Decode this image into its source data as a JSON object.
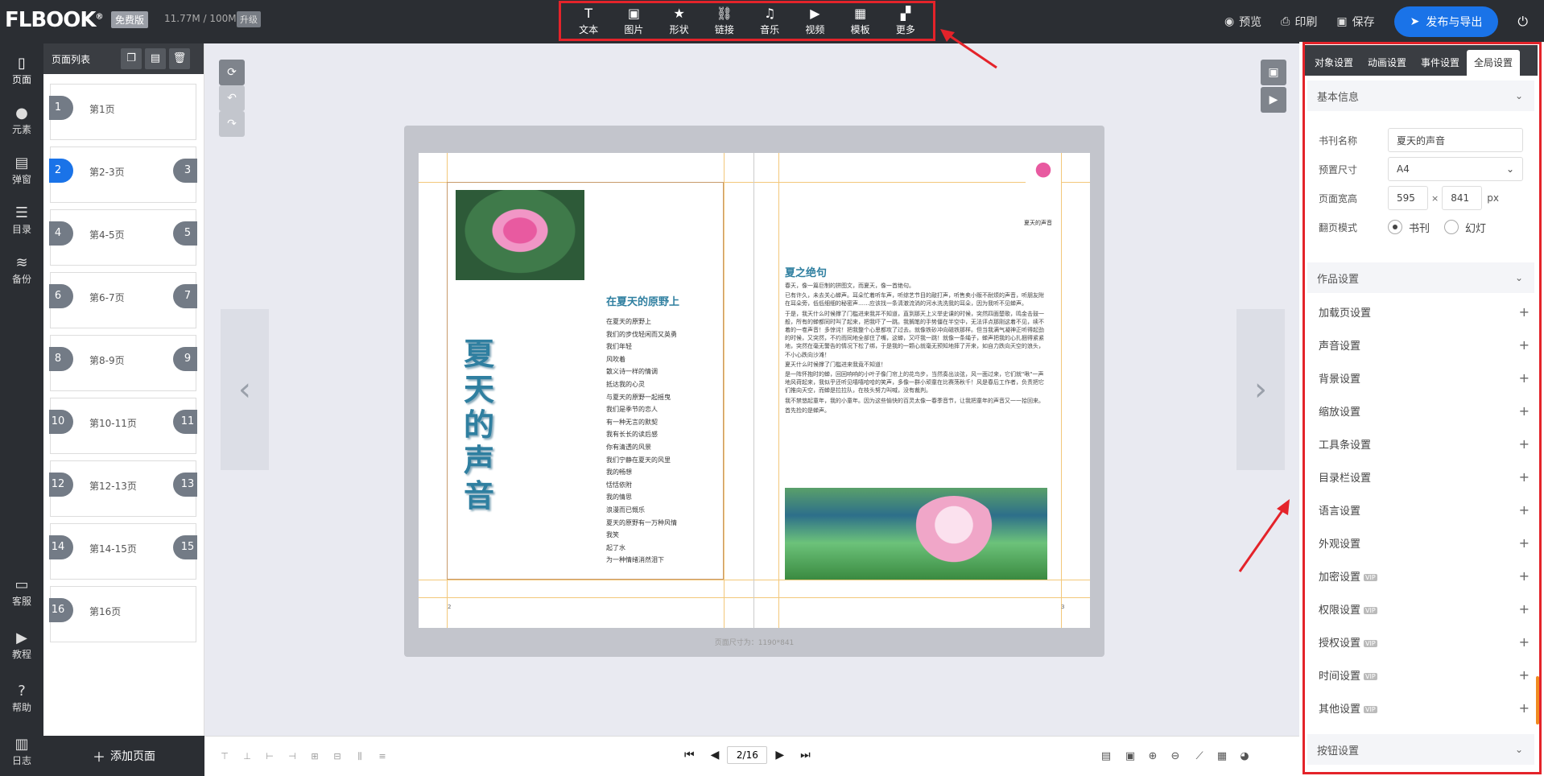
{
  "app": {
    "logo": "FLBOOK",
    "logo_mark": "®",
    "plan_badge": "免费版",
    "storage": "11.77M / 100M",
    "upgrade_label": "升级"
  },
  "insert_toolbar": [
    {
      "label": "文本",
      "icon": "text-icon",
      "glyph": "T"
    },
    {
      "label": "图片",
      "icon": "image-icon",
      "glyph": "▣"
    },
    {
      "label": "形状",
      "icon": "star-icon",
      "glyph": "★"
    },
    {
      "label": "链接",
      "icon": "link-icon",
      "glyph": "⛓"
    },
    {
      "label": "音乐",
      "icon": "music-icon",
      "glyph": "♫"
    },
    {
      "label": "视频",
      "icon": "video-icon",
      "glyph": "▶"
    },
    {
      "label": "模板",
      "icon": "template-icon",
      "glyph": "▦"
    },
    {
      "label": "更多",
      "icon": "more-icon",
      "glyph": "▞"
    }
  ],
  "top_actions": {
    "preview": "预览",
    "print": "印刷",
    "save": "保存",
    "publish": "发布与导出"
  },
  "left_nav": [
    {
      "label": "页面",
      "icon": "page-icon",
      "glyph": "▯"
    },
    {
      "label": "元素",
      "icon": "element-icon",
      "glyph": "●"
    },
    {
      "label": "弹窗",
      "icon": "popup-icon",
      "glyph": "▤"
    },
    {
      "label": "目录",
      "icon": "toc-icon",
      "glyph": "☰"
    },
    {
      "label": "备份",
      "icon": "backup-icon",
      "glyph": "≋"
    },
    {
      "label": "客服",
      "icon": "support-icon",
      "glyph": "▭"
    },
    {
      "label": "教程",
      "icon": "tutorial-icon",
      "glyph": "▶"
    },
    {
      "label": "帮助",
      "icon": "help-icon",
      "glyph": "?"
    },
    {
      "label": "日志",
      "icon": "log-icon",
      "glyph": "▥"
    }
  ],
  "page_list": {
    "title": "页面列表",
    "pages": [
      {
        "num_left": "1",
        "num_right": "",
        "label": "第1页"
      },
      {
        "num_left": "2",
        "num_right": "3",
        "label": "第2-3页"
      },
      {
        "num_left": "4",
        "num_right": "5",
        "label": "第4-5页"
      },
      {
        "num_left": "6",
        "num_right": "7",
        "label": "第6-7页"
      },
      {
        "num_left": "8",
        "num_right": "9",
        "label": "第8-9页"
      },
      {
        "num_left": "10",
        "num_right": "11",
        "label": "第10-11页"
      },
      {
        "num_left": "12",
        "num_right": "13",
        "label": "第12-13页"
      },
      {
        "num_left": "14",
        "num_right": "15",
        "label": "第14-15页"
      },
      {
        "num_left": "16",
        "num_right": "",
        "label": "第16页"
      }
    ],
    "add_page": "添加页面"
  },
  "book": {
    "vertical_title": "夏天的声音",
    "poem_title": "在夏天的原野上",
    "poem_lines": [
      "在夏天的原野上",
      "我们的步伐轻闲而又英勇",
      "我们年轻",
      "风吹着",
      "散义诗一样的情调",
      "抵达我的心灵",
      "与夏天的原野一起摇曳",
      "我们是季节的恋人",
      "有一种无言的默契",
      "我有长长的读后感",
      "你有清透的风景",
      "我们宁静在夏天的风里",
      "我的畅想",
      "恬恬依附",
      "我的情思",
      "浪漫而已慨乐",
      "夏天的原野有一万种风情",
      "我笑",
      "起了水",
      "为一种情绪消然泪下"
    ],
    "page_num_left": "2",
    "page_num_right": "3",
    "small_caption": "夏天的声音",
    "essay_title": "夏之绝句",
    "essay_paragraphs": [
      "春天，像一篇巨制的拼图文，而夏天，像一首绝句。",
      "已有许久，未去关心蝉声。耳朵忙着听车声，听综艺节目的敲打声，听售卖小贩不耐烦的声音，听朋友附在耳朵旁，低低细细的秘密声……应该找一条清澈流淌的河水洗洗我的耳朵，因为我听不见蝉声。",
      "于是，我天什么时候撑了门槛进来我并不知道，直到那天上义举史课的时候，突然四面楚歌，鸣金击鼓一般，所有的蝉都同时叫了起来，把我吓了一跳。我搁笔的手势僵在半空中，无法评点那刚这着不见，续不着的一卷声音！多惊诧！把我整个心思都攻了过去。就像铁砂冲向磁铁那样。但当我满气凝神正听得起劲的时候，又突然，不约而同地全部住了嘴，这蝉，又吓我一跳！就像一条绳子，蝉声把我的心扎捆得紧紧地，突然在毫无警告的情况下松了绑，于是我的一颗心就毫无预知地摔了开来，如自力跌向天空的浪头，不小心跌向沙滩！",
      "夏天什么时候撑了门槛进来我竟不知道！",
      "是一阵怀抱时的蝉，回回响响的小叶子像门帘上的花鸟步，当然奏出淡弦，风一面过来，它们就\"啾\"一声地风荷起来，我似乎还听见嘻嘻哈哈的笑声，多像一群小顽童在比赛荡秋千！风是春后工作者，负责把它们推向天空，而蝉是拉拉队，在枝头努力叫喊，没有裁判。",
      "我不禁悠起童年，我的小童年。因为这些愉快的百灵太像一春季音节，让我把童年的声音又一一拾回来。",
      "首先捡的是蝉声。"
    ],
    "size_note": "页面尺寸为：1190*841"
  },
  "bottom_bar": {
    "page_input": "2/16"
  },
  "right_panel": {
    "tabs": [
      "对象设置",
      "动画设置",
      "事件设置",
      "全局设置"
    ],
    "active_tab": "全局设置",
    "basic_info": {
      "header": "基本信息",
      "title_label": "书刊名称",
      "title_value": "夏天的声音",
      "size_label": "预置尺寸",
      "size_value": "A4",
      "dim_label": "页面宽高",
      "width": "595",
      "times": "×",
      "height": "841",
      "unit": "px",
      "flip_label": "翻页模式",
      "flip_book": "书刊",
      "flip_slide": "幻灯",
      "flip_selected": "书刊"
    },
    "work_settings": {
      "header": "作品设置",
      "items": [
        {
          "label": "加载页设置",
          "vip": false
        },
        {
          "label": "声音设置",
          "vip": false
        },
        {
          "label": "背景设置",
          "vip": false
        },
        {
          "label": "缩放设置",
          "vip": false
        },
        {
          "label": "工具条设置",
          "vip": false
        },
        {
          "label": "目录栏设置",
          "vip": false
        },
        {
          "label": "语言设置",
          "vip": false
        },
        {
          "label": "外观设置",
          "vip": false
        },
        {
          "label": "加密设置",
          "vip": true
        },
        {
          "label": "权限设置",
          "vip": true
        },
        {
          "label": "授权设置",
          "vip": true
        },
        {
          "label": "时间设置",
          "vip": true
        },
        {
          "label": "其他设置",
          "vip": true
        }
      ],
      "vip_badge": "VIP"
    },
    "button_settings": {
      "header": "按钮设置"
    }
  },
  "colors": {
    "dark_bar": "#2b2e33",
    "accent": "#1a73e8",
    "annotation_red": "#e4232a",
    "title_teal": "#2f7fa0"
  }
}
